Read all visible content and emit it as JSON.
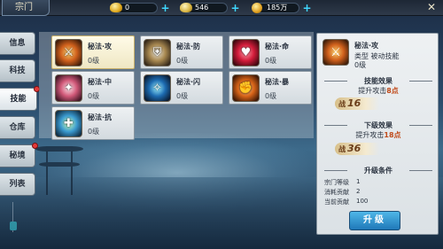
{
  "window": {
    "title": "宗门"
  },
  "resources": [
    {
      "icon": "gold-ingot-icon",
      "value": "0"
    },
    {
      "icon": "silver-ingot-icon",
      "value": "546"
    },
    {
      "icon": "coin-icon",
      "value": "185万"
    }
  ],
  "plus_label": "+",
  "sidebar": {
    "items": [
      {
        "label": "信息",
        "active": false,
        "alert": false
      },
      {
        "label": "科技",
        "active": false,
        "alert": false
      },
      {
        "label": "技能",
        "active": true,
        "alert": true
      },
      {
        "label": "仓库",
        "active": false,
        "alert": false
      },
      {
        "label": "秘境",
        "active": false,
        "alert": true
      },
      {
        "label": "列表",
        "active": false,
        "alert": false
      }
    ]
  },
  "skills": [
    {
      "name": "秘法·攻",
      "level": "0级",
      "icon": "attack-skill-icon",
      "glyph": "⚔"
    },
    {
      "name": "秘法·防",
      "level": "0级",
      "icon": "defense-skill-icon",
      "glyph": "⛨"
    },
    {
      "name": "秘法·命",
      "level": "0级",
      "icon": "life-skill-icon",
      "glyph": "♥"
    },
    {
      "name": "秘法·中",
      "level": "0级",
      "icon": "accuracy-skill-icon",
      "glyph": "✦"
    },
    {
      "name": "秘法·闪",
      "level": "0级",
      "icon": "dodge-skill-icon",
      "glyph": "✧"
    },
    {
      "name": "秘法·暴",
      "level": "0级",
      "icon": "crit-skill-icon",
      "glyph": "✊"
    },
    {
      "name": "秘法·抗",
      "level": "0级",
      "icon": "resist-skill-icon",
      "glyph": "✚"
    }
  ],
  "detail": {
    "name": "秘法·攻",
    "type": "类型 被动技能",
    "level": "0级",
    "effect_header": "技能效果",
    "effect_text_pre": "提升攻击",
    "effect_value": "8点",
    "power_label": "战",
    "power_value": "16",
    "next_header": "下级效果",
    "next_text_pre": "提升攻击",
    "next_value": "18点",
    "next_power_value": "36",
    "cond_header": "升级条件",
    "conditions": [
      {
        "label": "宗门等级",
        "value": "1"
      },
      {
        "label": "消耗贡献",
        "value": "2"
      },
      {
        "label": "当前贡献",
        "value": "100"
      }
    ],
    "upgrade_button": "升级"
  }
}
